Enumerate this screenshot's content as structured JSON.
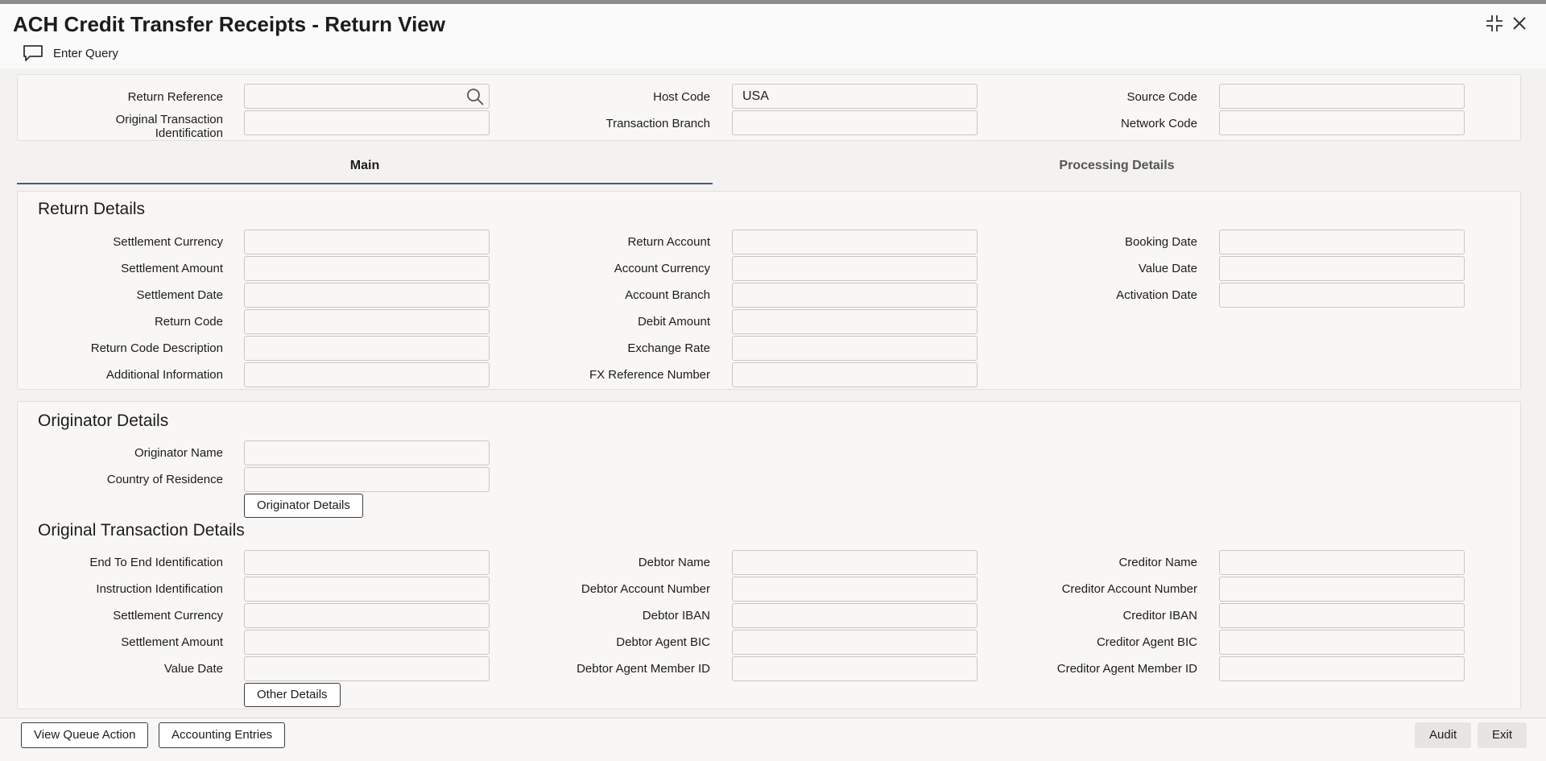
{
  "window": {
    "title": "ACH Credit Transfer Receipts - Return View",
    "controls": [
      "maximize-icon",
      "close-icon"
    ]
  },
  "toolbar": {
    "enter_query": "Enter Query",
    "enter_query_icon": "chat-bubble-icon"
  },
  "header": {
    "return_reference_label": "Return Reference",
    "return_reference_value": "",
    "orig_txn_id_label_line1": "Original Transaction",
    "orig_txn_id_label_line2": "Identification",
    "orig_txn_id_value": "",
    "host_code_label": "Host Code",
    "host_code_value": "USA",
    "txn_branch_label": "Transaction Branch",
    "txn_branch_value": "",
    "source_code_label": "Source Code",
    "source_code_value": "",
    "network_code_label": "Network Code",
    "network_code_value": ""
  },
  "tabs": {
    "main": "Main",
    "processing": "Processing Details"
  },
  "return_details": {
    "title": "Return Details",
    "col1": [
      "Settlement Currency",
      "Settlement Amount",
      "Settlement Date",
      "Return Code",
      "Return Code Description",
      "Additional Information"
    ],
    "col2": [
      "Return Account",
      "Account Currency",
      "Account Branch",
      "Debit Amount",
      "Exchange Rate",
      "FX Reference Number"
    ],
    "col3": [
      "Booking Date",
      "Value Date",
      "Activation Date"
    ]
  },
  "originator_details": {
    "title": "Originator Details",
    "labels": [
      "Originator Name",
      "Country of Residence"
    ],
    "button": "Originator Details"
  },
  "original_txn_details": {
    "title": "Original Transaction Details",
    "col1": [
      "End To End Identification",
      "Instruction Identification",
      "Settlement Currency",
      "Settlement Amount",
      "Value Date"
    ],
    "col2": [
      "Debtor Name",
      "Debtor Account Number",
      "Debtor IBAN",
      "Debtor Agent BIC",
      "Debtor Agent Member ID"
    ],
    "col3": [
      "Creditor Name",
      "Creditor Account Number",
      "Creditor IBAN",
      "Creditor Agent BIC",
      "Creditor Agent Member ID"
    ],
    "button": "Other Details"
  },
  "footer": {
    "view_queue_action": "View Queue Action",
    "accounting_entries": "Accounting Entries",
    "audit": "Audit",
    "exit": "Exit"
  },
  "colors": {
    "background": "#f3f2f0",
    "panel": "#f8f7f5",
    "tab_underline": "#4a5b70"
  }
}
